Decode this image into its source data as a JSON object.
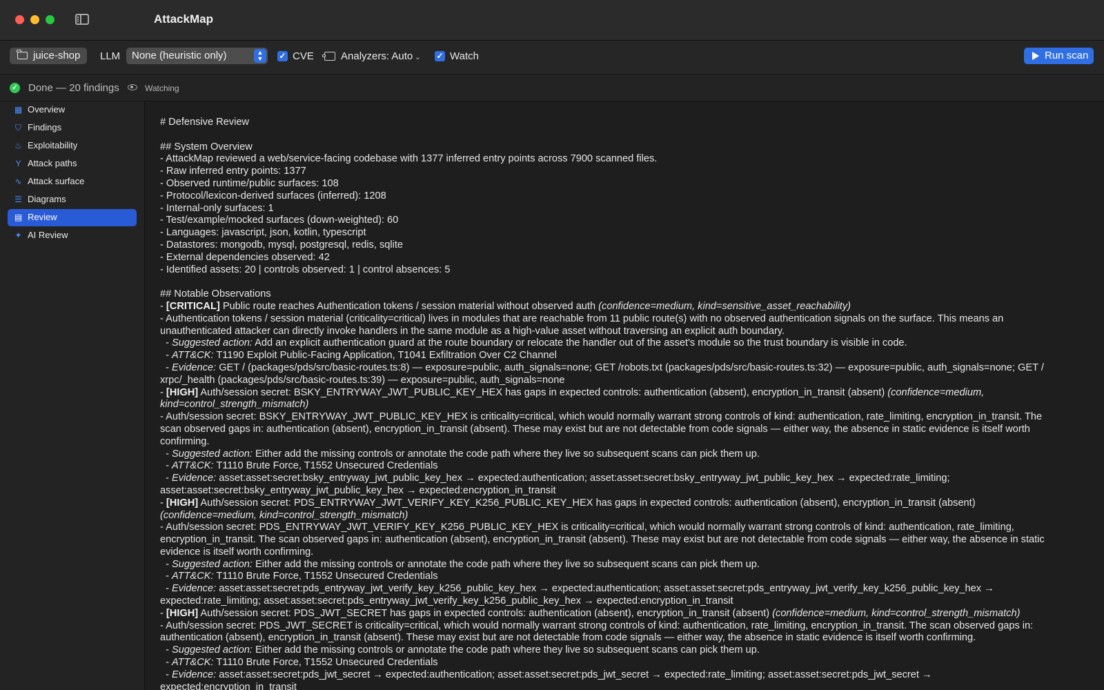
{
  "app": {
    "title": "AttackMap"
  },
  "toolbar": {
    "project": "juice-shop",
    "llm_label": "LLM",
    "llm_value": "None (heuristic only)",
    "cve_label": "CVE",
    "cve_checked": true,
    "analyzers_label": "Analyzers: Auto",
    "watch_label": "Watch",
    "watch_checked": true,
    "run_label": "Run scan",
    "accent": "#2f6fe3"
  },
  "status": {
    "text": "Done — 20 findings",
    "watching": "Watching",
    "ok_color": "#34c759"
  },
  "sidebar": {
    "items": [
      {
        "label": "Overview",
        "icon": "grid-icon"
      },
      {
        "label": "Findings",
        "icon": "shield-icon"
      },
      {
        "label": "Exploitability",
        "icon": "flame-icon"
      },
      {
        "label": "Attack paths",
        "icon": "branch-icon"
      },
      {
        "label": "Attack surface",
        "icon": "route-icon"
      },
      {
        "label": "Diagrams",
        "icon": "diagram-icon"
      },
      {
        "label": "Review",
        "icon": "document-icon",
        "active": true
      },
      {
        "label": "AI Review",
        "icon": "sparkles-icon"
      }
    ]
  },
  "review": {
    "heading": "# Defensive Review",
    "overview_heading": "## System Overview",
    "overview": [
      "- AttackMap reviewed a web/service-facing codebase with 1377 inferred entry points across 7900 scanned files.",
      "- Raw inferred entry points: 1377",
      "- Observed runtime/public surfaces: 108",
      "- Protocol/lexicon-derived surfaces (inferred): 1208",
      "- Internal-only surfaces: 1",
      "- Test/example/mocked surfaces (down-weighted): 60",
      "- Languages: javascript, json, kotlin, typescript",
      "- Datastores: mongodb, mysql, postgresql, redis, sqlite",
      "- External dependencies observed: 42",
      "- Identified assets: 20 | controls observed: 1 | control absences: 5"
    ],
    "observations_heading": "## Notable Observations",
    "findings": [
      {
        "severity": "[CRITICAL]",
        "title": "Public route reaches Authentication tokens / session material without observed auth",
        "meta": "(confidence=medium, kind=sensitive_asset_reachability)",
        "meta_cont": "",
        "description": [
          "  - Authentication tokens / session material (criticality=critical) lives in modules that are reachable from 11 public route(s) with no observed authentication signals on the surface. This means an",
          "unauthenticated attacker can directly invoke handlers in the same module as a high-value asset without traversing an explicit auth boundary."
        ],
        "action_label": "Suggested action:",
        "action": "Add an explicit authentication guard at the route boundary or relocate the handler out of the asset's module so the trust boundary is visible in code.",
        "attack_label": "ATT&CK:",
        "attack": "T1190 Exploit Public-Facing Application, T1041 Exfiltration Over C2 Channel",
        "evidence_label": "Evidence:",
        "evidence": [
          "GET / (packages/pds/src/basic-routes.ts:8) — exposure=public, auth_signals=none; GET /robots.txt (packages/pds/src/basic-routes.ts:32) — exposure=public, auth_signals=none; GET /",
          "xrpc/_health (packages/pds/src/basic-routes.ts:39) — exposure=public, auth_signals=none"
        ]
      },
      {
        "severity": "[HIGH]",
        "title": "Auth/session secret: BSKY_ENTRYWAY_JWT_PUBLIC_KEY_HEX has gaps in expected controls: authentication (absent), encryption_in_transit (absent)",
        "meta": "(confidence=medium,",
        "meta_cont": "kind=control_strength_mismatch)",
        "description": [
          "  - Auth/session secret: BSKY_ENTRYWAY_JWT_PUBLIC_KEY_HEX is criticality=critical, which would normally warrant strong controls of kind: authentication, rate_limiting, encryption_in_transit. The",
          "scan observed gaps in: authentication (absent), encryption_in_transit (absent). These may exist but are not detectable from code signals — either way, the absence in static evidence is itself worth",
          "confirming."
        ],
        "action_label": "Suggested action:",
        "action": "Either add the missing controls or annotate the code path where they live so subsequent scans can pick them up.",
        "attack_label": "ATT&CK:",
        "attack": "T1110 Brute Force, T1552 Unsecured Credentials",
        "evidence_label": "Evidence:",
        "evidence": [
          "asset:asset:secret:bsky_entryway_jwt_public_key_hex → expected:authentication; asset:asset:secret:bsky_entryway_jwt_public_key_hex → expected:rate_limiting;",
          "asset:asset:secret:bsky_entryway_jwt_public_key_hex → expected:encryption_in_transit"
        ]
      },
      {
        "severity": "[HIGH]",
        "title": "Auth/session secret: PDS_ENTRYWAY_JWT_VERIFY_KEY_K256_PUBLIC_KEY_HEX has gaps in expected controls: authentication (absent), encryption_in_transit (absent)",
        "meta": "",
        "meta_cont": "(confidence=medium, kind=control_strength_mismatch)",
        "description": [
          "  - Auth/session secret: PDS_ENTRYWAY_JWT_VERIFY_KEY_K256_PUBLIC_KEY_HEX is criticality=critical, which would normally warrant strong controls of kind: authentication, rate_limiting,",
          "encryption_in_transit. The scan observed gaps in: authentication (absent), encryption_in_transit (absent). These may exist but are not detectable from code signals — either way, the absence in static",
          "evidence is itself worth confirming."
        ],
        "action_label": "Suggested action:",
        "action": "Either add the missing controls or annotate the code path where they live so subsequent scans can pick them up.",
        "attack_label": "ATT&CK:",
        "attack": "T1110 Brute Force, T1552 Unsecured Credentials",
        "evidence_label": "Evidence:",
        "evidence": [
          "asset:asset:secret:pds_entryway_jwt_verify_key_k256_public_key_hex → expected:authentication; asset:asset:secret:pds_entryway_jwt_verify_key_k256_public_key_hex →",
          "expected:rate_limiting; asset:asset:secret:pds_entryway_jwt_verify_key_k256_public_key_hex → expected:encryption_in_transit"
        ]
      },
      {
        "severity": "[HIGH]",
        "title": "Auth/session secret: PDS_JWT_SECRET has gaps in expected controls: authentication (absent), encryption_in_transit (absent)",
        "meta": "(confidence=medium, kind=control_strength_mismatch)",
        "meta_cont": "",
        "description": [
          "  - Auth/session secret: PDS_JWT_SECRET is criticality=critical, which would normally warrant strong controls of kind: authentication, rate_limiting, encryption_in_transit. The scan observed gaps in:",
          "authentication (absent), encryption_in_transit (absent). These may exist but are not detectable from code signals — either way, the absence in static evidence is itself worth confirming."
        ],
        "action_label": "Suggested action:",
        "action": "Either add the missing controls or annotate the code path where they live so subsequent scans can pick them up.",
        "attack_label": "ATT&CK:",
        "attack": "T1110 Brute Force, T1552 Unsecured Credentials",
        "evidence_label": "Evidence:",
        "evidence": [
          "asset:asset:secret:pds_jwt_secret → expected:authentication; asset:asset:secret:pds_jwt_secret → expected:rate_limiting; asset:asset:secret:pds_jwt_secret →",
          "expected:encryption_in_transit"
        ]
      }
    ]
  }
}
